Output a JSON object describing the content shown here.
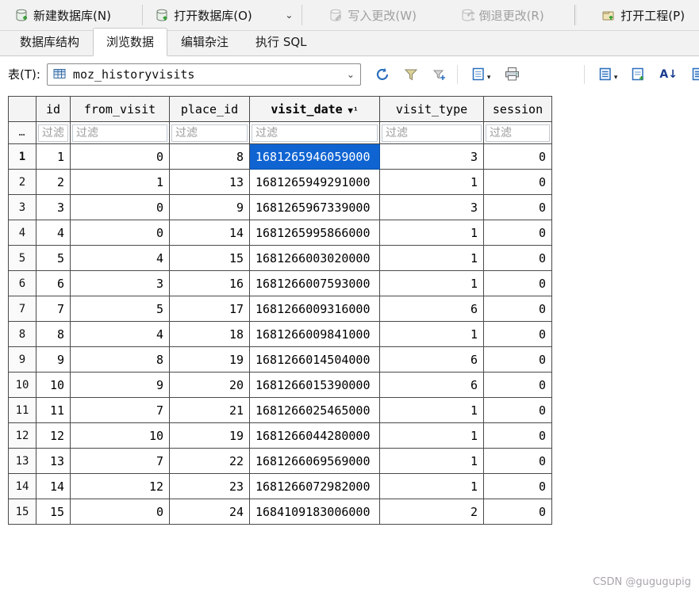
{
  "toolbar": {
    "new_db": "新建数据库(N)",
    "open_db": "打开数据库(O)",
    "write_changes": "写入更改(W)",
    "revert_changes": "倒退更改(R)",
    "open_project": "打开工程(P)"
  },
  "tabs": {
    "structure": "数据库结构",
    "browse": "浏览数据",
    "pragmas": "编辑杂注",
    "sql": "执行 SQL"
  },
  "table_bar": {
    "label": "表(T):",
    "table_name": "moz_historyvisits"
  },
  "icons": {
    "open_db_dropdown": "⌄",
    "combo_chevron": "⌄",
    "doc_dropdown": "▾",
    "sort_glyph": "A↓"
  },
  "grid": {
    "filter_placeholder": "过滤",
    "gutter_filter": "…",
    "columns": [
      {
        "name": "id",
        "align": "right"
      },
      {
        "name": "from_visit",
        "align": "right"
      },
      {
        "name": "place_id",
        "align": "right"
      },
      {
        "name": "visit_date",
        "align": "left",
        "sort_indicator": " ▼¹"
      },
      {
        "name": "visit_type",
        "align": "right"
      },
      {
        "name": "session",
        "align": "right"
      }
    ],
    "rows": [
      [
        1,
        0,
        8,
        "1681265946059000",
        3,
        0
      ],
      [
        2,
        1,
        13,
        "1681265949291000",
        1,
        0
      ],
      [
        3,
        0,
        9,
        "1681265967339000",
        3,
        0
      ],
      [
        4,
        0,
        14,
        "1681265995866000",
        1,
        0
      ],
      [
        5,
        4,
        15,
        "1681266003020000",
        1,
        0
      ],
      [
        6,
        3,
        16,
        "1681266007593000",
        1,
        0
      ],
      [
        7,
        5,
        17,
        "1681266009316000",
        6,
        0
      ],
      [
        8,
        4,
        18,
        "1681266009841000",
        1,
        0
      ],
      [
        9,
        8,
        19,
        "1681266014504000",
        6,
        0
      ],
      [
        10,
        9,
        20,
        "1681266015390000",
        6,
        0
      ],
      [
        11,
        7,
        21,
        "1681266025465000",
        1,
        0
      ],
      [
        12,
        10,
        19,
        "1681266044280000",
        1,
        0
      ],
      [
        13,
        7,
        22,
        "1681266069569000",
        1,
        0
      ],
      [
        14,
        12,
        23,
        "1681266072982000",
        1,
        0
      ],
      [
        15,
        0,
        24,
        "1684109183006000",
        2,
        0
      ]
    ],
    "selected": {
      "row": 1,
      "col": "visit_date",
      "value": "1681265946059000"
    }
  },
  "colors": {
    "selection": "#0f64d2",
    "accent_blue": "#2a6fbd",
    "toolbar_green": "#2f9e2f"
  },
  "watermark": "CSDN @gugugupig"
}
